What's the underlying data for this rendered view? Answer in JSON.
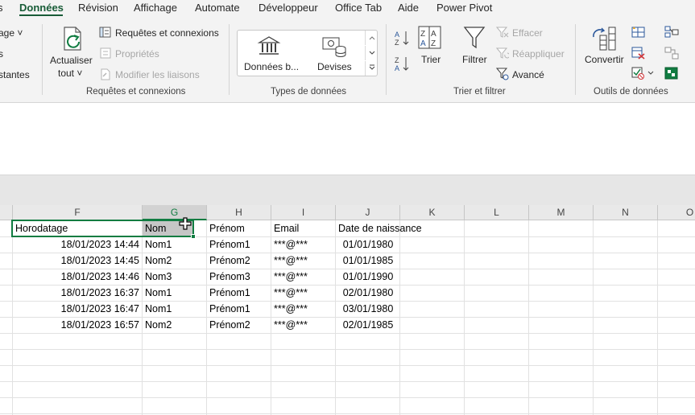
{
  "tabs": [
    {
      "label": "s",
      "active": false
    },
    {
      "label": "Données",
      "active": true
    },
    {
      "label": "Révision",
      "active": false
    },
    {
      "label": "Affichage",
      "active": false
    },
    {
      "label": "Automate",
      "active": false
    },
    {
      "label": "Développeur",
      "active": false
    },
    {
      "label": "Office Tab",
      "active": false
    },
    {
      "label": "Aide",
      "active": false
    },
    {
      "label": "Power Pivot",
      "active": false
    }
  ],
  "ribbon": {
    "partial_group": {
      "item1": "age ˅",
      "item2": "s",
      "item3": "stantes"
    },
    "queries": {
      "refresh_label_1": "Actualiser",
      "refresh_label_2": "tout ˅",
      "queries_connections": "Requêtes et connexions",
      "properties": "Propriétés",
      "edit_links": "Modifier les liaisons",
      "group_label": "Requêtes et connexions"
    },
    "data_types": {
      "stocks": "Données b...",
      "currencies": "Devises",
      "group_label": "Types de données"
    },
    "sort_filter": {
      "sort": "Trier",
      "filter": "Filtrer",
      "clear": "Effacer",
      "reapply": "Réappliquer",
      "advanced": "Avancé",
      "group_label": "Trier et filtrer"
    },
    "data_tools": {
      "convert": "Convertir",
      "group_label": "Outils de données"
    }
  },
  "grid": {
    "columns": [
      "F",
      "G",
      "H",
      "I",
      "J",
      "K",
      "L",
      "M",
      "N",
      "O"
    ],
    "selected_column": "G",
    "header_row": [
      "Horodatage",
      "Nom",
      "Prénom",
      "Email",
      "Date de naissance"
    ],
    "rows": [
      [
        "18/01/2023 14:44",
        "Nom1",
        "Prénom1",
        "***@***",
        "01/01/1980"
      ],
      [
        "18/01/2023 14:45",
        "Nom2",
        "Prénom2",
        "***@***",
        "01/01/1985"
      ],
      [
        "18/01/2023 14:46",
        "Nom3",
        "Prénom3",
        "***@***",
        "01/01/1990"
      ],
      [
        "18/01/2023 16:37",
        "Nom1",
        "Prénom1",
        "***@***",
        "02/01/1980"
      ],
      [
        "18/01/2023 16:47",
        "Nom1",
        "Prénom1",
        "***@***",
        "03/01/1980"
      ],
      [
        "18/01/2023 16:57",
        "Nom2",
        "Prénom2",
        "***@***",
        "02/01/1985"
      ]
    ]
  },
  "colors": {
    "accent": "#107c41",
    "tab_active": "#185c37"
  }
}
